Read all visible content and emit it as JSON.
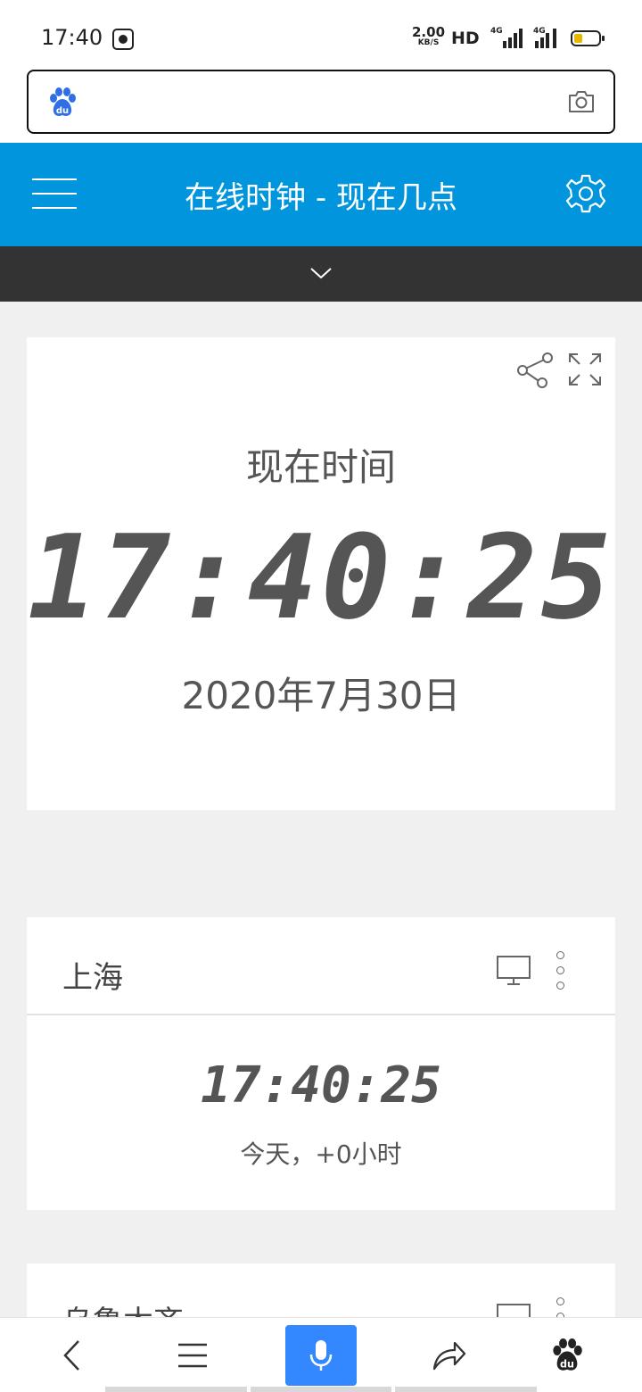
{
  "status_bar": {
    "time": "17:40",
    "net_speed_value": "2.00",
    "net_speed_unit": "KB/S",
    "hd_label": "HD",
    "signal1_label": "4G",
    "signal2_label": "4G",
    "battery_color": "#e5b800"
  },
  "search": {
    "placeholder": "",
    "left_icon": "baidu-paw-icon",
    "right_icon": "camera-icon"
  },
  "header": {
    "title": "在线时钟 - 现在几点",
    "background": "#0095dd",
    "left_icon": "menu-icon",
    "right_icon": "gear-icon"
  },
  "subbar": {
    "icon": "chevron-down-icon"
  },
  "main_clock": {
    "label": "现在时间",
    "time": "17:40:25",
    "date": "2020年7月30日"
  },
  "city_cards": [
    {
      "name": "上海",
      "time": "17:40:25",
      "offset": "今天，+0小时"
    },
    {
      "name": "乌鲁木齐"
    }
  ],
  "bottom_nav": {
    "items": [
      "back-icon",
      "menu-icon",
      "mic-icon",
      "share-icon",
      "baidu-paw-icon"
    ],
    "accent": "#3388ff"
  }
}
